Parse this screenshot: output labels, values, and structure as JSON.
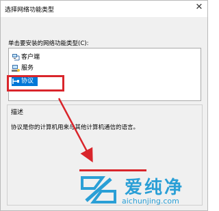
{
  "window": {
    "title": "选择网络功能类型",
    "close_glyph": "✕"
  },
  "instruction": "单击要安装的网络功能类型(C):",
  "list": {
    "items": [
      {
        "label": "客户端",
        "icon": "client-network-icon"
      },
      {
        "label": "服务",
        "icon": "service-icon"
      },
      {
        "label": "协议",
        "icon": "protocol-icon",
        "selected": true
      }
    ]
  },
  "description": {
    "group_label": "描述",
    "text": "协议是你的计算机用来与其他计算机通信的语言。"
  },
  "watermark": {
    "brand": "爱纯净",
    "url": "aichunjing.com"
  },
  "colors": {
    "selection": "#0078d7",
    "annotation_red": "#d9252b",
    "watermark_blue": "#2a9fd6"
  }
}
